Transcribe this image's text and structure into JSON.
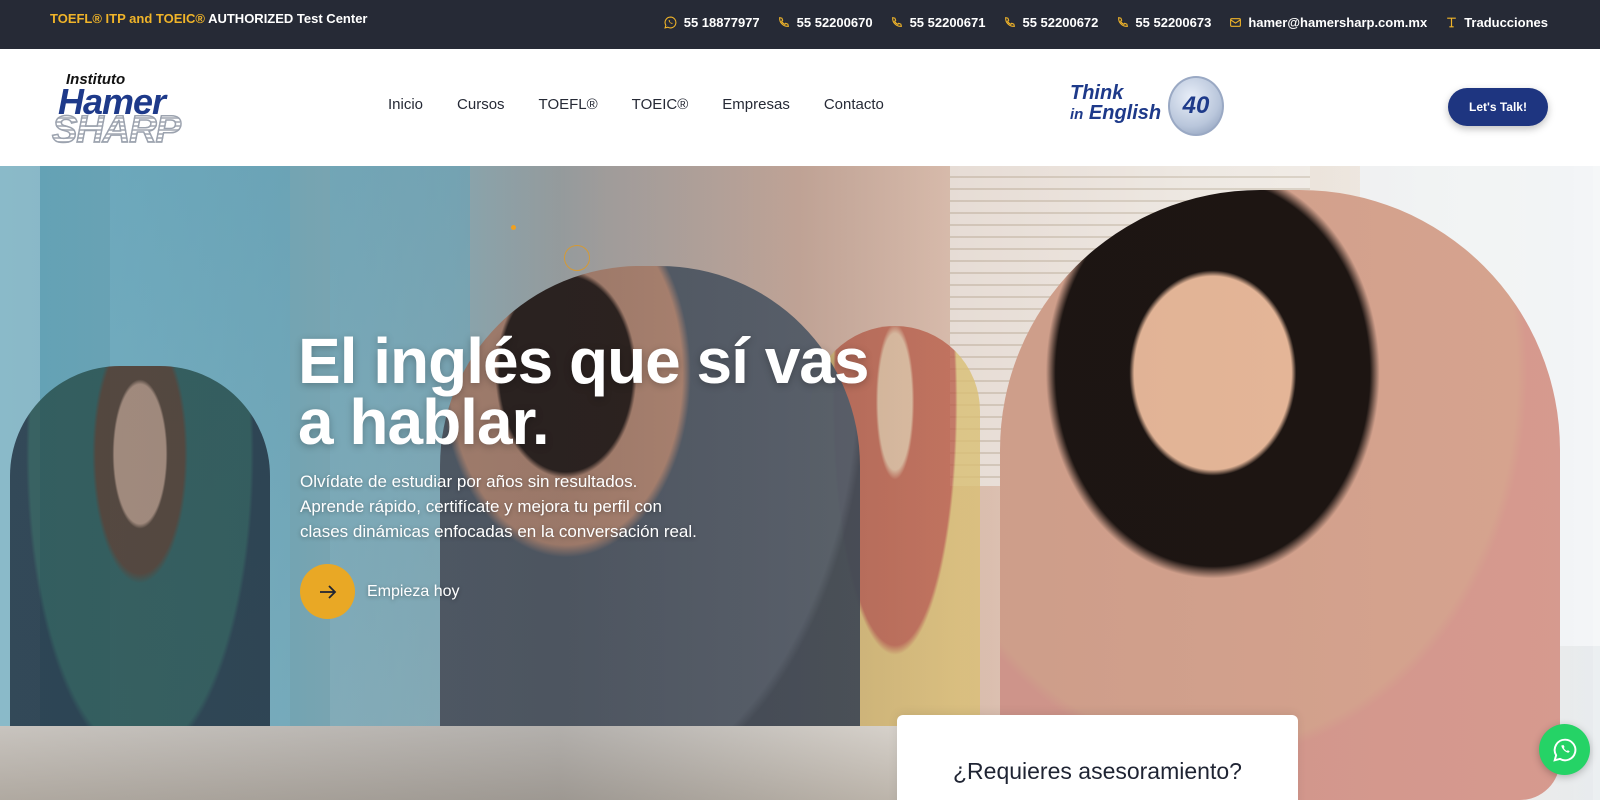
{
  "topbar": {
    "cert_highlight": "TOEFL® ITP and TOEIC®",
    "cert_rest": "AUTHORIZED Test Center",
    "contacts": [
      {
        "icon": "whatsapp-icon",
        "text": "55 18877977"
      },
      {
        "icon": "phone-icon",
        "text": "55 52200670"
      },
      {
        "icon": "phone-icon",
        "text": "55 52200671"
      },
      {
        "icon": "phone-icon",
        "text": "55 52200672"
      },
      {
        "icon": "phone-icon",
        "text": "55 52200673"
      },
      {
        "icon": "mail-icon",
        "text": "hamer@hamersharp.com.mx"
      },
      {
        "icon": "translate-icon",
        "text": "Traducciones"
      }
    ],
    "icon_color": "#f0b429",
    "background": "#262a36"
  },
  "logo": {
    "line1": "Instituto",
    "line2": "Hamer",
    "line3": "SHARP"
  },
  "nav": [
    "Inicio",
    "Cursos",
    "TOEFL®",
    "TOEIC®",
    "Empresas",
    "Contacto"
  ],
  "think_logo": {
    "line1": "Think",
    "line2_small": "in",
    "line2": "English",
    "badge": "40"
  },
  "talk_button": "Let's Talk!",
  "hero": {
    "headline_line1": "El inglés que sí vas",
    "headline_line2": "a hablar.",
    "sub_line1": "Olvídate de estudiar por años sin resultados.",
    "sub_line2": "Aprende rápido, certifícate y mejora tu perfil con",
    "sub_line3": "clases dinámicas enfocadas en la conversación real.",
    "cta_label": "Empieza hoy",
    "cta_icon": "arrow-right-icon",
    "accent": "#e9a825"
  },
  "asesor_card": {
    "title": "¿Requieres asesoramiento?"
  },
  "whatsapp_float": {
    "icon": "whatsapp-icon",
    "color": "#25d366"
  }
}
